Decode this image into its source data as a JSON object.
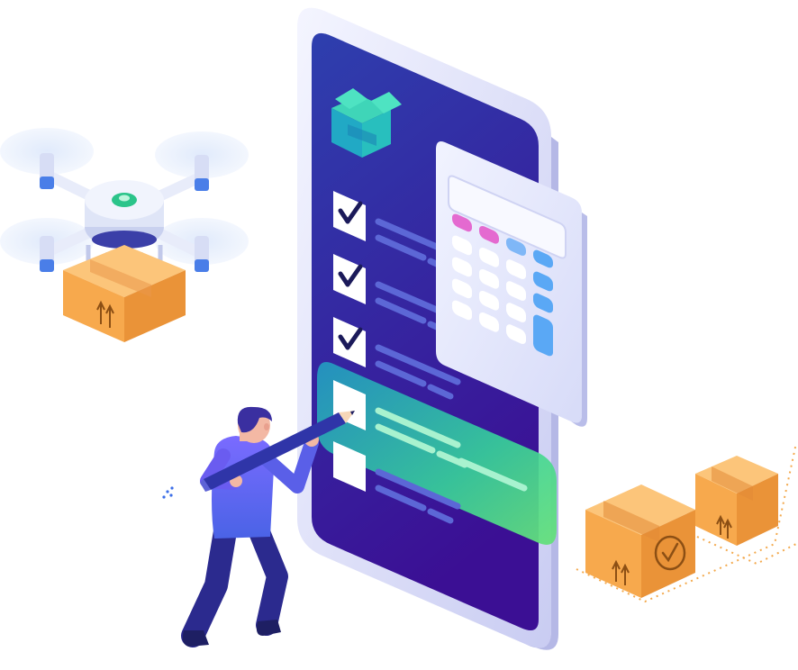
{
  "scene": {
    "checklist": {
      "items": [
        {
          "checked": true
        },
        {
          "checked": true
        },
        {
          "checked": true
        },
        {
          "checked": false,
          "active": true
        },
        {
          "checked": false
        }
      ]
    },
    "colors": {
      "phone_screen_top": "#2f3aa8",
      "phone_screen_bottom": "#3a1296",
      "phone_frame": "#e6e8fb",
      "highlight_green": "#38d39f",
      "highlight_cyan": "#2ac1d7",
      "box_orange": "#f7a94d",
      "box_dark": "#e38b2f",
      "calculator_body": "#e9ecff",
      "calculator_screen": "#f5f6ff",
      "calculator_key_blue": "#5aa8f5",
      "calculator_key_pink": "#e86ad3",
      "person_shirt": "#6a5cf0",
      "person_pants": "#2b2a8e",
      "drone_body": "#dfe5f7",
      "drone_accent": "#2bc48a"
    },
    "icons": [
      "open-box-logo-icon",
      "checkbox-icon",
      "calculator-icon",
      "drone-icon",
      "package-icon",
      "pencil-icon",
      "person-icon"
    ]
  }
}
